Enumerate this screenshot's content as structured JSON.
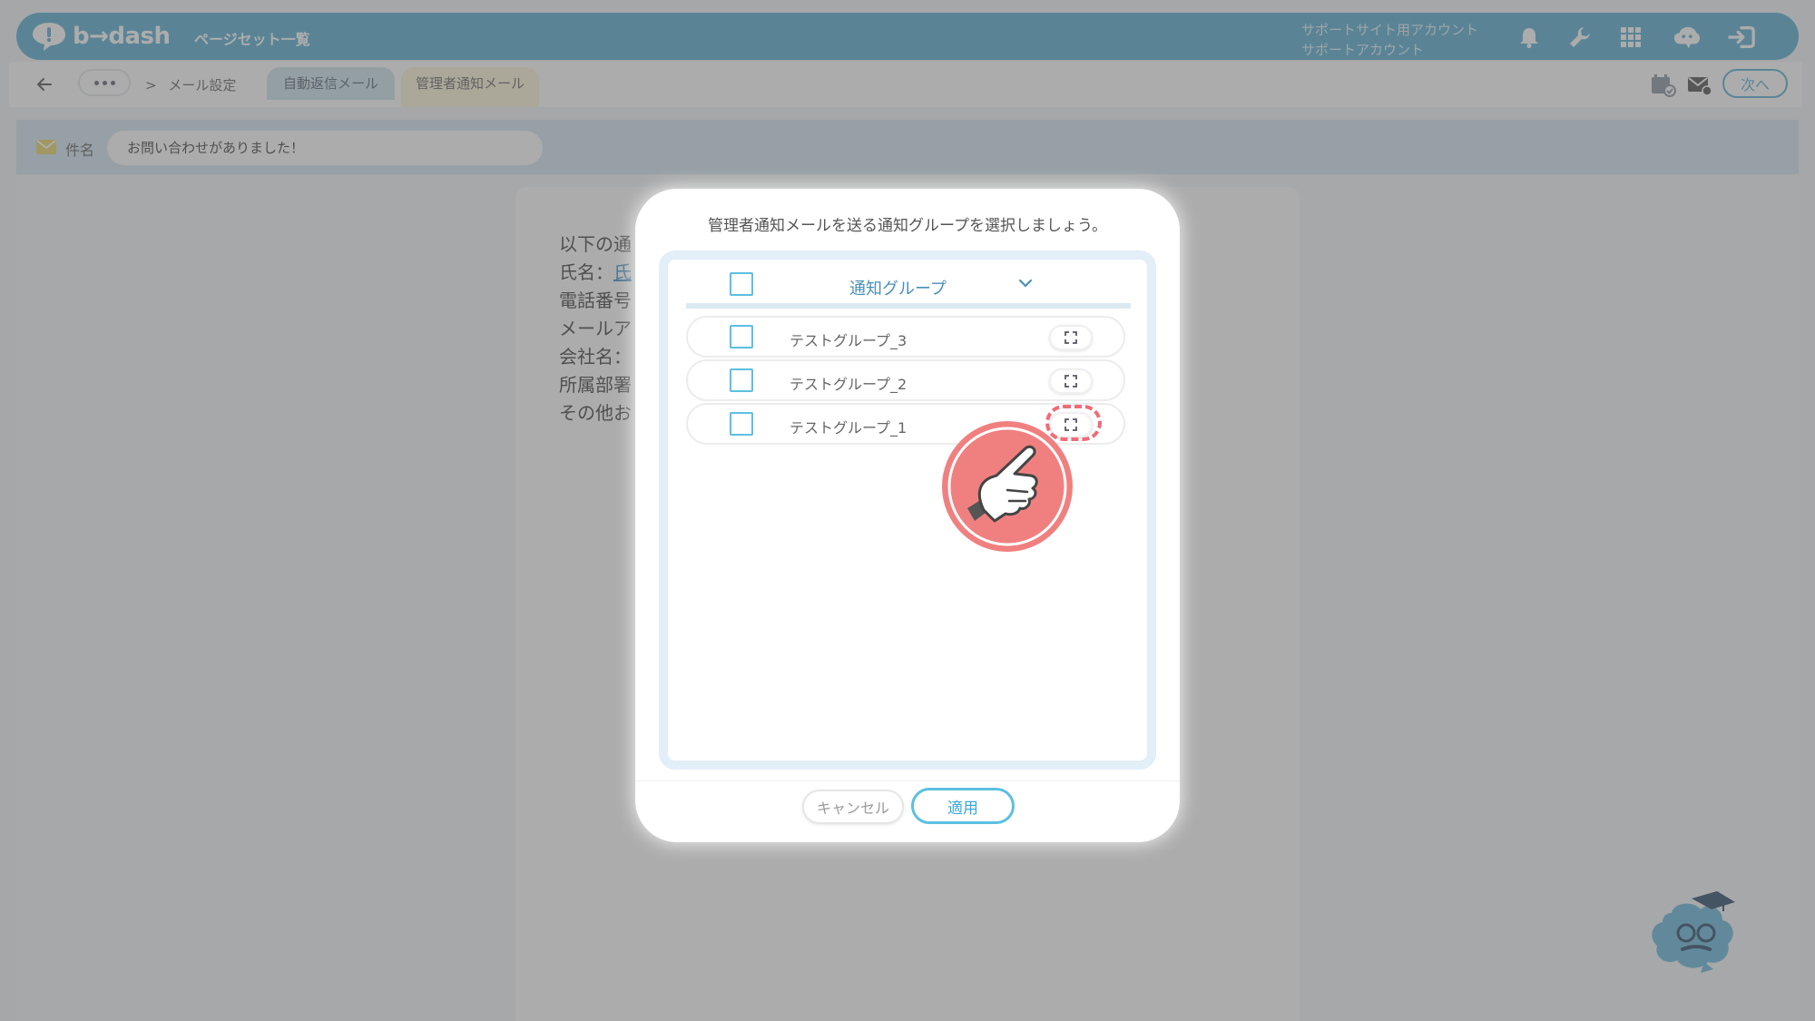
{
  "header": {
    "logo_text": "b→dash",
    "title": "ページセット一覧",
    "account_line1": "サポートサイト用アカウント",
    "account_line2": "サポートアカウント",
    "icons": [
      "bell-icon",
      "wrench-icon",
      "grid-icon",
      "cloud-chat-icon",
      "logout-icon"
    ],
    "color": "#5aaed2"
  },
  "subnav": {
    "crumb_separator": ">",
    "crumb": "メール設定",
    "tab_auto_reply": "自動返信メール",
    "tab_admin_notice": "管理者通知メール",
    "next_label": "次へ"
  },
  "subject": {
    "label": "件名",
    "value": "お問い合わせがありました！"
  },
  "document": {
    "lines": [
      "以下の通",
      "氏名：",
      "電話番号",
      "メールア",
      "会社名：",
      "所属部署",
      "その他お"
    ],
    "link_fragment": "氏"
  },
  "modal": {
    "title": "管理者通知メールを送る通知グループを選択しましょう。",
    "column_header": "通知グループ",
    "groups": [
      {
        "name": "テストグループ_3",
        "checked": false
      },
      {
        "name": "テストグループ_2",
        "checked": false
      },
      {
        "name": "テストグループ_1",
        "checked": false
      }
    ],
    "cancel_label": "キャンセル",
    "apply_label": "適用",
    "accent": "#5cc0e0",
    "highlight_color": "#f06a78"
  }
}
